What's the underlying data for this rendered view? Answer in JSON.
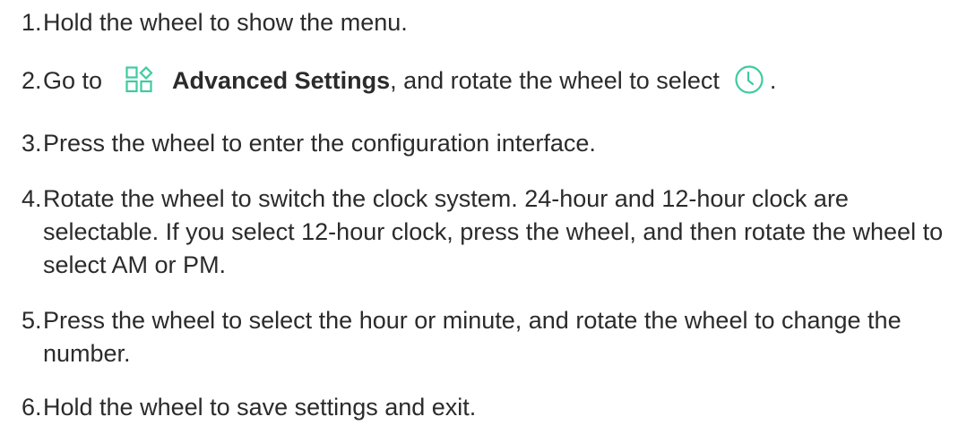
{
  "steps": [
    {
      "num": "1.",
      "text": "Hold the wheel to show the menu."
    },
    {
      "num": "2.",
      "pre": "Go to",
      "bold": "Advanced Settings",
      "mid": ", and rotate the wheel to select",
      "end": ".",
      "icon_settings": "advanced-settings-icon",
      "icon_clock": "clock-icon",
      "icon_color": "#3ecb9f"
    },
    {
      "num": "3.",
      "text": "Press the wheel to enter the configuration interface."
    },
    {
      "num": "4.",
      "text": "Rotate the wheel to switch the clock system. 24-hour and 12-hour clock are selectable. If you select 12-hour clock, press the wheel, and then rotate the wheel to select AM or PM."
    },
    {
      "num": "5.",
      "text": "Press the wheel to select the hour or minute, and rotate the wheel to change the number."
    },
    {
      "num": "6.",
      "text": "Hold the wheel to save settings and exit."
    }
  ]
}
